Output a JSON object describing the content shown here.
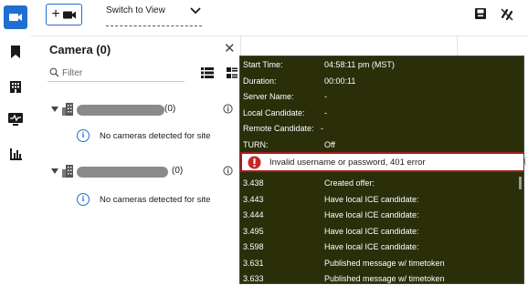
{
  "toolbar": {
    "add_camera_plus": "+",
    "view_select": {
      "label": "Switch to View"
    }
  },
  "nav": {
    "items": [
      {
        "icon": "video-camera-icon",
        "active": true
      },
      {
        "icon": "bookmark-icon",
        "active": false
      },
      {
        "icon": "building-icon",
        "active": false
      },
      {
        "icon": "monitor-activity-icon",
        "active": false
      },
      {
        "icon": "bar-chart-icon",
        "active": false
      }
    ]
  },
  "panel": {
    "title": "Camera (0)",
    "filter_placeholder": "Filter",
    "sites": [
      {
        "count": "(0)",
        "notice": "No cameras detected for site"
      },
      {
        "count": "(0)",
        "notice": "No cameras detected for site"
      }
    ]
  },
  "debug": {
    "rows": [
      {
        "key": "Start Time:",
        "value": "04:58:11 pm (MST)"
      },
      {
        "key": "Duration:",
        "value": "00:00:11"
      },
      {
        "key": "Server Name:",
        "value": "-"
      },
      {
        "key": "Local Candidate:",
        "value": "-"
      },
      {
        "key": "Remote Candidate:",
        "value": "-"
      },
      {
        "key": "TURN:",
        "value": "Off"
      }
    ],
    "error": "Invalid username or password, 401 error",
    "log": [
      {
        "time": "3.438",
        "message": "Created offer:"
      },
      {
        "time": "3.443",
        "message": "Have local ICE candidate:"
      },
      {
        "time": "3.444",
        "message": "Have local ICE candidate:"
      },
      {
        "time": "3.495",
        "message": "Have local ICE candidate:"
      },
      {
        "time": "3.598",
        "message": "Have local ICE candidate:"
      },
      {
        "time": "3.631",
        "message": "Published message w/ timetoken"
      },
      {
        "time": "3.633",
        "message": "Published message w/ timetoken"
      }
    ]
  },
  "colors": {
    "accent": "#1f6fd1",
    "debug_bg": "#2a2f0a",
    "error_border": "#a61c1c",
    "error_icon": "#c62828"
  }
}
